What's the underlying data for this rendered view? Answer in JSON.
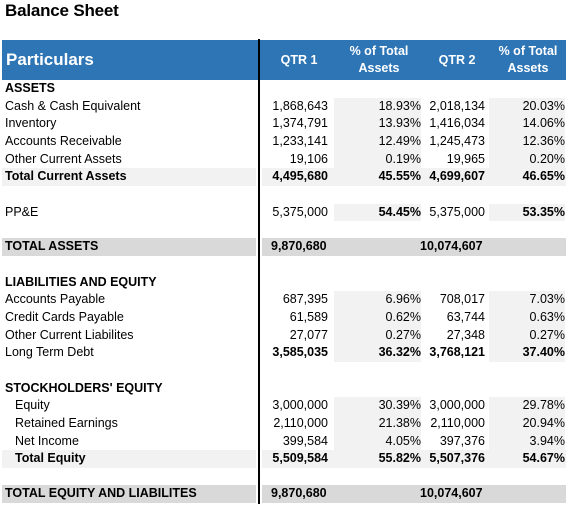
{
  "title": "Balance Sheet",
  "header": {
    "particulars": "Particulars",
    "qtr1": "QTR 1",
    "pct1": "% of Total Assets",
    "qtr2": "QTR 2",
    "pct2": "% of Total Assets"
  },
  "colors": {
    "header_bg": "#2e75b6",
    "subtotal_bg": "#f2f2f2",
    "total_bg": "#d9d9d9"
  },
  "assets": {
    "heading": "ASSETS",
    "rows": [
      {
        "label": "Cash & Cash Equivalent",
        "q1": "1,868,643",
        "p1": "18.93%",
        "q2": "2,018,134",
        "p2": "20.03%"
      },
      {
        "label": "Inventory",
        "q1": "1,374,791",
        "p1": "13.93%",
        "q2": "1,416,034",
        "p2": "14.06%"
      },
      {
        "label": "Accounts Receivable",
        "q1": "1,233,141",
        "p1": "12.49%",
        "q2": "1,245,473",
        "p2": "12.36%"
      },
      {
        "label": "Other Current Assets",
        "q1": "19,106",
        "p1": "0.19%",
        "q2": "19,965",
        "p2": "0.20%"
      }
    ],
    "total_current": {
      "label": "Total Current Assets",
      "q1": "4,495,680",
      "p1": "45.55%",
      "q2": "4,699,607",
      "p2": "46.65%"
    },
    "ppe": {
      "label": "PP&E",
      "q1": "5,375,000",
      "p1": "54.45%",
      "q2": "5,375,000",
      "p2": "53.35%"
    },
    "total": {
      "label": "TOTAL ASSETS",
      "q1": "9,870,680",
      "q2": "10,074,607"
    }
  },
  "liabilities": {
    "heading": "LIABILITIES AND EQUITY",
    "rows": [
      {
        "label": "Accounts Payable",
        "q1": "687,395",
        "p1": "6.96%",
        "q2": "708,017",
        "p2": "7.03%"
      },
      {
        "label": "Credit Cards Payable",
        "q1": "61,589",
        "p1": "0.62%",
        "q2": "63,744",
        "p2": "0.63%"
      },
      {
        "label": "Other Current Liabilites",
        "q1": "27,077",
        "p1": "0.27%",
        "q2": "27,348",
        "p2": "0.27%"
      }
    ],
    "long_term": {
      "label": "Long Term Debt",
      "q1": "3,585,035",
      "p1": "36.32%",
      "q2": "3,768,121",
      "p2": "37.40%"
    }
  },
  "equity": {
    "heading": "STOCKHOLDERS' EQUITY",
    "rows": [
      {
        "label": "Equity",
        "q1": "3,000,000",
        "p1": "30.39%",
        "q2": "3,000,000",
        "p2": "29.78%"
      },
      {
        "label": "Retained Earnings",
        "q1": "2,110,000",
        "p1": "21.38%",
        "q2": "2,110,000",
        "p2": "20.94%"
      },
      {
        "label": "Net Income",
        "q1": "399,584",
        "p1": "4.05%",
        "q2": "397,376",
        "p2": "3.94%"
      }
    ],
    "total": {
      "label": "Total Equity",
      "q1": "5,509,584",
      "p1": "55.82%",
      "q2": "5,507,376",
      "p2": "54.67%"
    }
  },
  "grand_total": {
    "label": "TOTAL EQUITY AND LIABILITES",
    "q1": "9,870,680",
    "q2": "10,074,607"
  }
}
